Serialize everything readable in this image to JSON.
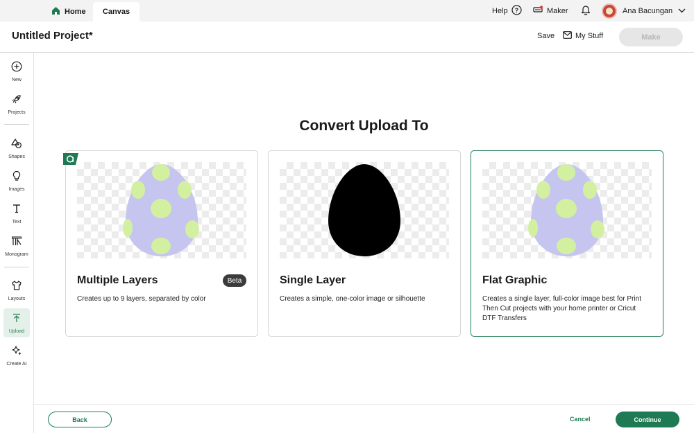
{
  "topbar": {
    "home_label": "Home",
    "canvas_label": "Canvas",
    "help_label": "Help",
    "maker_label": "Maker",
    "user_name": "Ana Bacungan"
  },
  "project": {
    "title": "Untitled Project*",
    "save_label": "Save",
    "mystuff_label": "My Stuff",
    "make_label": "Make"
  },
  "sidebar": {
    "items": [
      {
        "label": "New",
        "icon": "plus-circle-icon"
      },
      {
        "label": "Projects",
        "icon": "rocket-icon"
      },
      {
        "label": "Shapes",
        "icon": "shapes-icon"
      },
      {
        "label": "Images",
        "icon": "lightbulb-icon"
      },
      {
        "label": "Text",
        "icon": "text-icon"
      },
      {
        "label": "Monogram",
        "icon": "monogram-icon"
      },
      {
        "label": "Layouts",
        "icon": "shirt-icon"
      },
      {
        "label": "Upload",
        "icon": "upload-icon"
      },
      {
        "label": "Create AI",
        "icon": "sparkle-icon"
      }
    ],
    "active": "Upload"
  },
  "main": {
    "title": "Convert Upload To",
    "cards": [
      {
        "title": "Multiple Layers",
        "badge": "Beta",
        "description": "Creates up to 9 layers, separated by color"
      },
      {
        "title": "Single Layer",
        "description": "Creates a simple, one-color image or silhouette"
      },
      {
        "title": "Flat Graphic",
        "description": "Creates a single layer, full-color image best for Print Then Cut projects with your home printer or Cricut DTF Transfers"
      }
    ],
    "selected_card": "Flat Graphic"
  },
  "footer": {
    "back_label": "Back",
    "cancel_label": "Cancel",
    "continue_label": "Continue"
  },
  "colors": {
    "accent": "#1d7a52",
    "egg_body": "#c5c5ef",
    "egg_spots": "#d3f0a0",
    "silhouette": "#000000"
  }
}
